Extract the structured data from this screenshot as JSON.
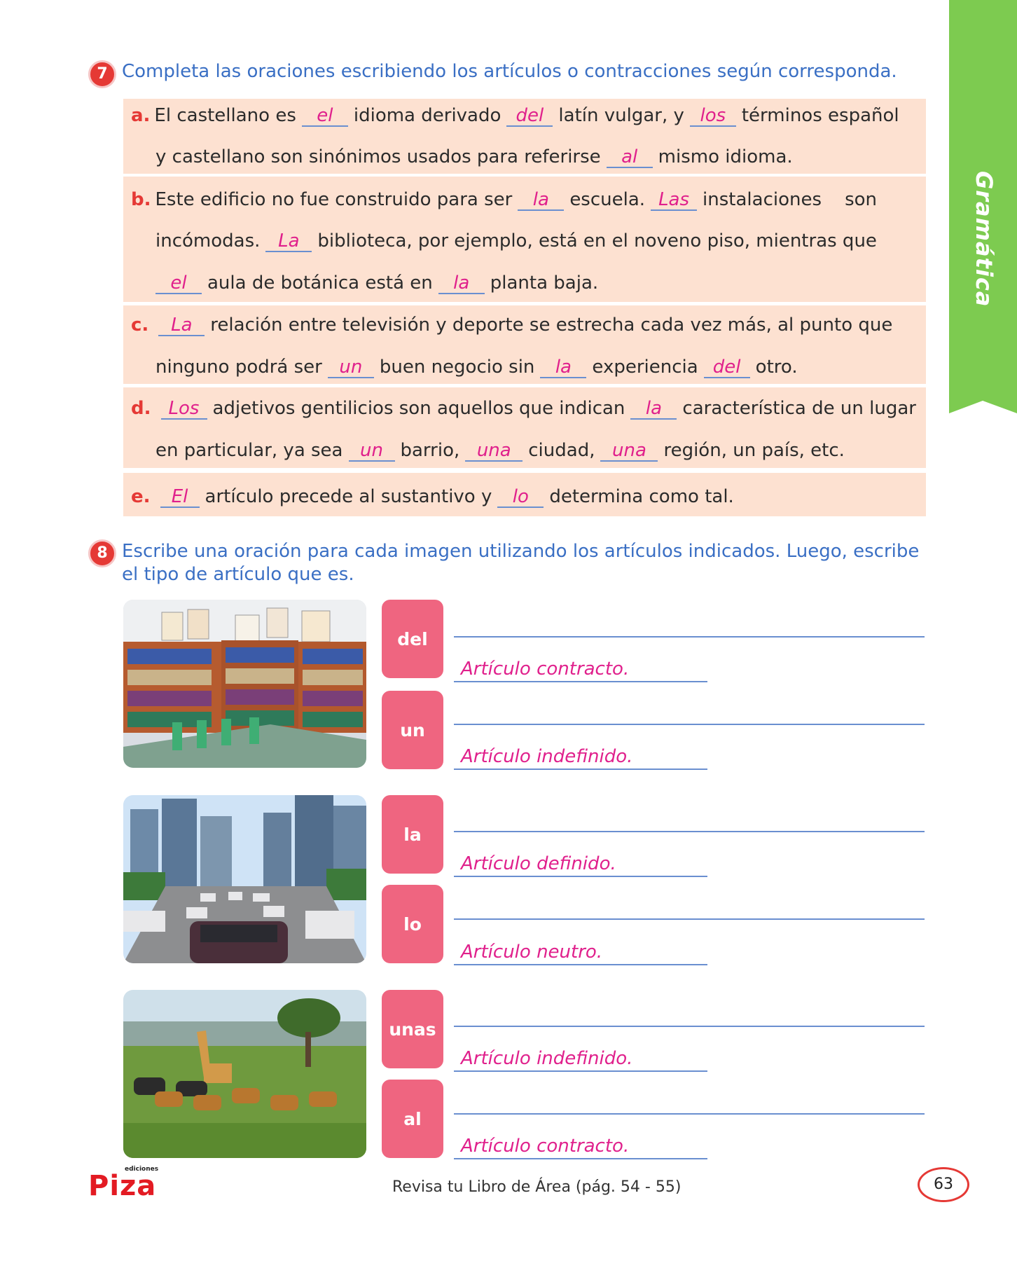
{
  "side_tab": {
    "label": "Gramática",
    "color": "#7dcb50"
  },
  "section7": {
    "number": "7",
    "instruction": "Completa las oraciones escribiendo los artículos o contracciones según corresponda.",
    "rows": [
      {
        "letter": "a.",
        "l1": {
          "t1": "El castellano es",
          "b1": "el",
          "t2": "idioma derivado",
          "b2": "del",
          "t3": "latín vulgar, y",
          "b3": "los",
          "t4": "términos español"
        },
        "l2": {
          "t1": "y castellano son sinónimos usados para referirse",
          "b1": "al",
          "t2": "mismo idioma."
        }
      },
      {
        "letter": "b.",
        "l1": {
          "t1": "Este edificio no fue construido para ser",
          "b1": "la",
          "t2": "escuela.",
          "b2": "Las",
          "t3": "instalaciones    son"
        },
        "l2": {
          "t1": "incómodas.",
          "b1": "La",
          "t2": "biblioteca, por ejemplo, está en el noveno piso, mientras que"
        },
        "l3": {
          "b1": "el",
          "t1": "aula de botánica está en",
          "b2": "la",
          "t2": "planta baja."
        }
      },
      {
        "letter": "c.",
        "l1": {
          "b1": "La",
          "t1": "relación entre televisión y deporte se estrecha cada vez más, al punto que"
        },
        "l2": {
          "t1": "ninguno podrá ser",
          "b1": "un",
          "t2": "buen negocio sin",
          "b2": "la",
          "t3": "experiencia",
          "b3": "del",
          "t4": "otro."
        }
      },
      {
        "letter": "d.",
        "l1": {
          "b1": "Los",
          "t1": "adjetivos gentilicios son aquellos que indican",
          "b2": "la",
          "t2": "característica de un lugar"
        },
        "l2": {
          "t1": "en particular, ya sea",
          "b1": "un",
          "t2": "barrio,",
          "b2": "una",
          "t3": "ciudad,",
          "b3": "una",
          "t4": "región, un país, etc."
        }
      },
      {
        "letter": "e.",
        "l1": {
          "b1": "El",
          "t1": "artículo precede al sustantivo y",
          "b2": "lo",
          "t2": "determina como tal."
        }
      }
    ]
  },
  "section8": {
    "number": "8",
    "instruction_line1": "Escribe una oración para cada imagen utilizando los artículos indicados. Luego, escribe",
    "instruction_line2": "el tipo de artículo que es.",
    "items": [
      {
        "article": "del",
        "answer": "Artículo contracto."
      },
      {
        "article": "un",
        "answer": "Artículo indefinido."
      },
      {
        "article": "la",
        "answer": "Artículo definido."
      },
      {
        "article": "lo",
        "answer": "Artículo neutro."
      },
      {
        "article": "unas",
        "answer": "Artículo indefinido."
      },
      {
        "article": "al",
        "answer": "Artículo contracto."
      }
    ],
    "images": [
      "library",
      "city-traffic",
      "savanna-animals"
    ]
  },
  "footer": {
    "logo_small": "ediciones",
    "logo_main": "Piza",
    "reference": "Revisa tu Libro de Área (pág. 54 - 55)",
    "page_number": "63"
  }
}
